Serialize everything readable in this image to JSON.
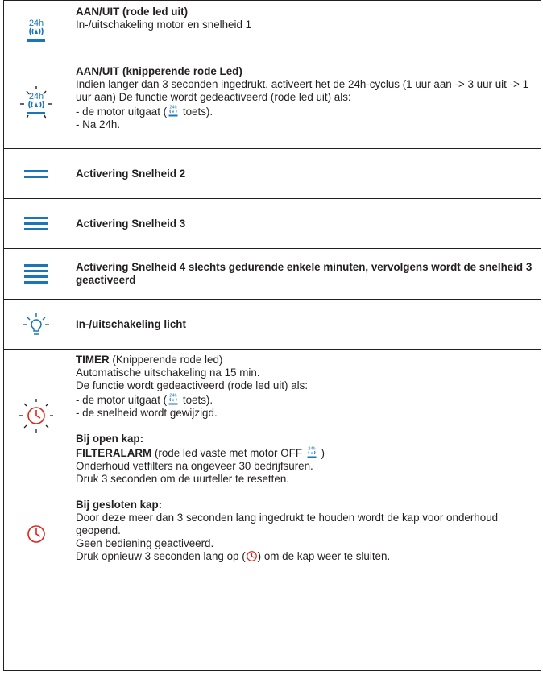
{
  "rows": [
    {
      "icon": "fan-24h-icon",
      "title": "AAN/UIT (rode led uit)",
      "lines": [
        "In-/uitschakeling motor en snelheid 1"
      ]
    },
    {
      "icon": "fan-24h-blinking-icon",
      "title": "AAN/UIT (knipperende rode Led)",
      "text": "Indien langer dan 3 seconden ingedrukt, activeert het de 24h-cyclus (1 uur aan -> 3 uur uit -> 1 uur aan) De functie wordt gedeactiveerd (rode led uit) als:",
      "motor_pre": "- de motor uitgaat (",
      "motor_post": " toets).",
      "after": "- Na 24h."
    },
    {
      "icon": "speed-2-icon",
      "title": "Activering Snelheid 2"
    },
    {
      "icon": "speed-3-icon",
      "title": "Activering Snelheid 3"
    },
    {
      "icon": "speed-4-icon",
      "title": "Activering Snelheid 4 slechts gedurende enkele minuten, vervolgens wordt de snelheid 3 geactiveerd"
    },
    {
      "icon": "light-bulb-icon",
      "title": "In-/uitschakeling licht"
    }
  ],
  "timer": {
    "title_bold": "TIMER",
    "title_rest": " (Knipperende rode led)",
    "l1": "Automatische uitschakeling na 15 min.",
    "l2": "De functie wordt gedeactiveerd (rode led uit) als:",
    "l3_pre": "- de motor uitgaat (",
    "l3_post": " toets).",
    "l4": "- de snelheid wordt gewijzigd.",
    "open_head": "Bij open kap:",
    "filter_bold": "FILTERALARM",
    "filter_rest": " (rode led vaste met motor OFF ",
    "filter_end": " )",
    "open_l2": "Onderhoud vetfilters na ongeveer 30 bedrijfsuren.",
    "open_l3": "Druk 3 seconden om de uurteller te resetten.",
    "closed_head": "Bij gesloten kap:",
    "closed_l1": "Door deze meer dan 3 seconden lang ingedrukt te houden wordt de kap voor onderhoud geopend.",
    "closed_l2": "Geen bediening geactiveerd.",
    "closed_l3_pre": "Druk opnieuw 3 seconden lang op (",
    "closed_l3_post": ") om de kap weer te sluiten."
  },
  "icon_labels": {
    "h24": "24h"
  },
  "colors": {
    "icon_blue": "#1a76b9",
    "icon_red": "#e2231a",
    "text": "#231f20"
  }
}
